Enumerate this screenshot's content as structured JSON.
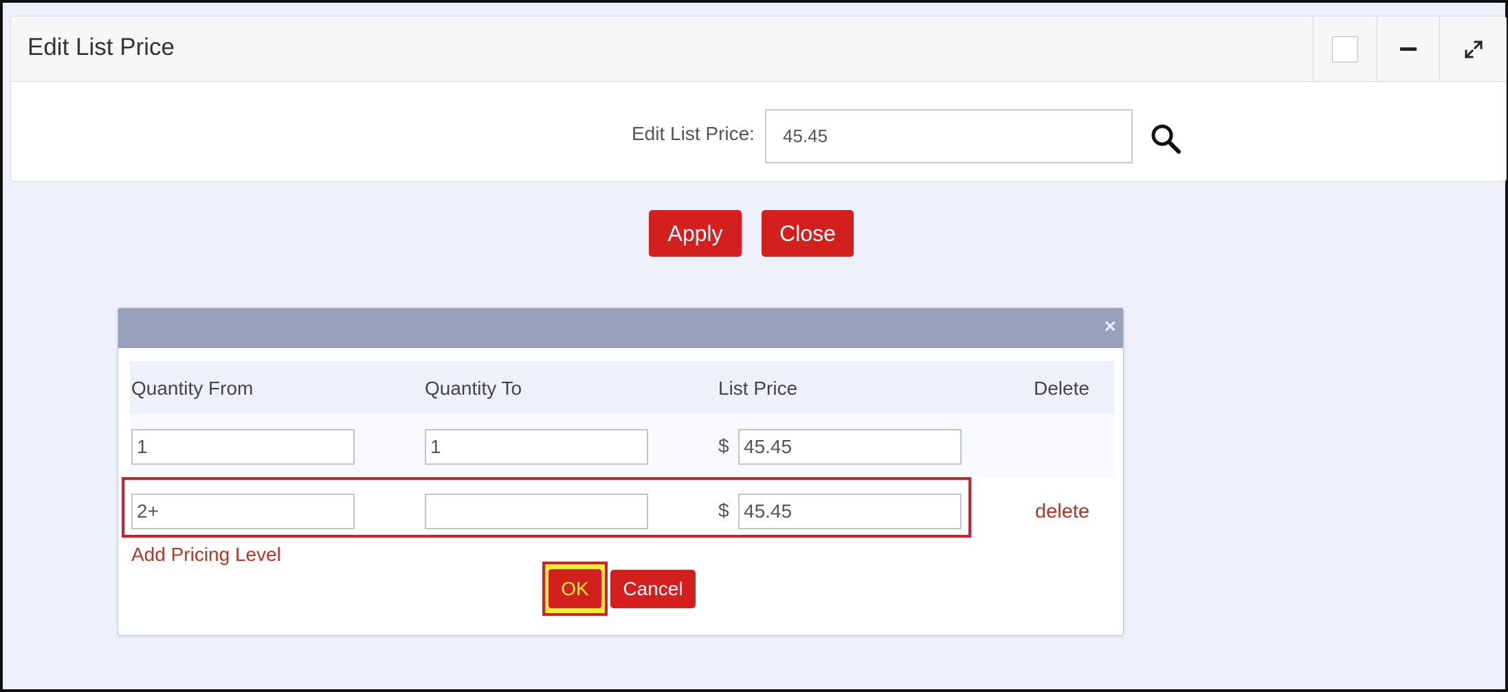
{
  "panel": {
    "title": "Edit List Price",
    "list_price_label": "Edit List Price:",
    "list_price_value": "45.45"
  },
  "actions": {
    "apply_label": "Apply",
    "close_label": "Close"
  },
  "dialog": {
    "close_glyph": "×",
    "columns": [
      "Quantity From",
      "Quantity To",
      "List Price",
      "Delete"
    ],
    "rows": [
      {
        "qty_from": "1",
        "qty_to": "1",
        "currency": "$",
        "price": "45.45",
        "delete": ""
      },
      {
        "qty_from": "2+",
        "qty_to": "",
        "currency": "$",
        "price": "45.45",
        "delete": "delete"
      }
    ],
    "add_level_label": "Add Pricing Level",
    "ok_label": "OK",
    "cancel_label": "Cancel"
  },
  "colors": {
    "accent_red": "#d3201f",
    "highlight_yellow": "#f6ea3b",
    "dialog_bar": "#98a0bb",
    "page_bg": "#eef1fb"
  },
  "icons": [
    "checkbox-icon",
    "minimize-icon",
    "expand-icon",
    "search-icon",
    "close-icon"
  ]
}
